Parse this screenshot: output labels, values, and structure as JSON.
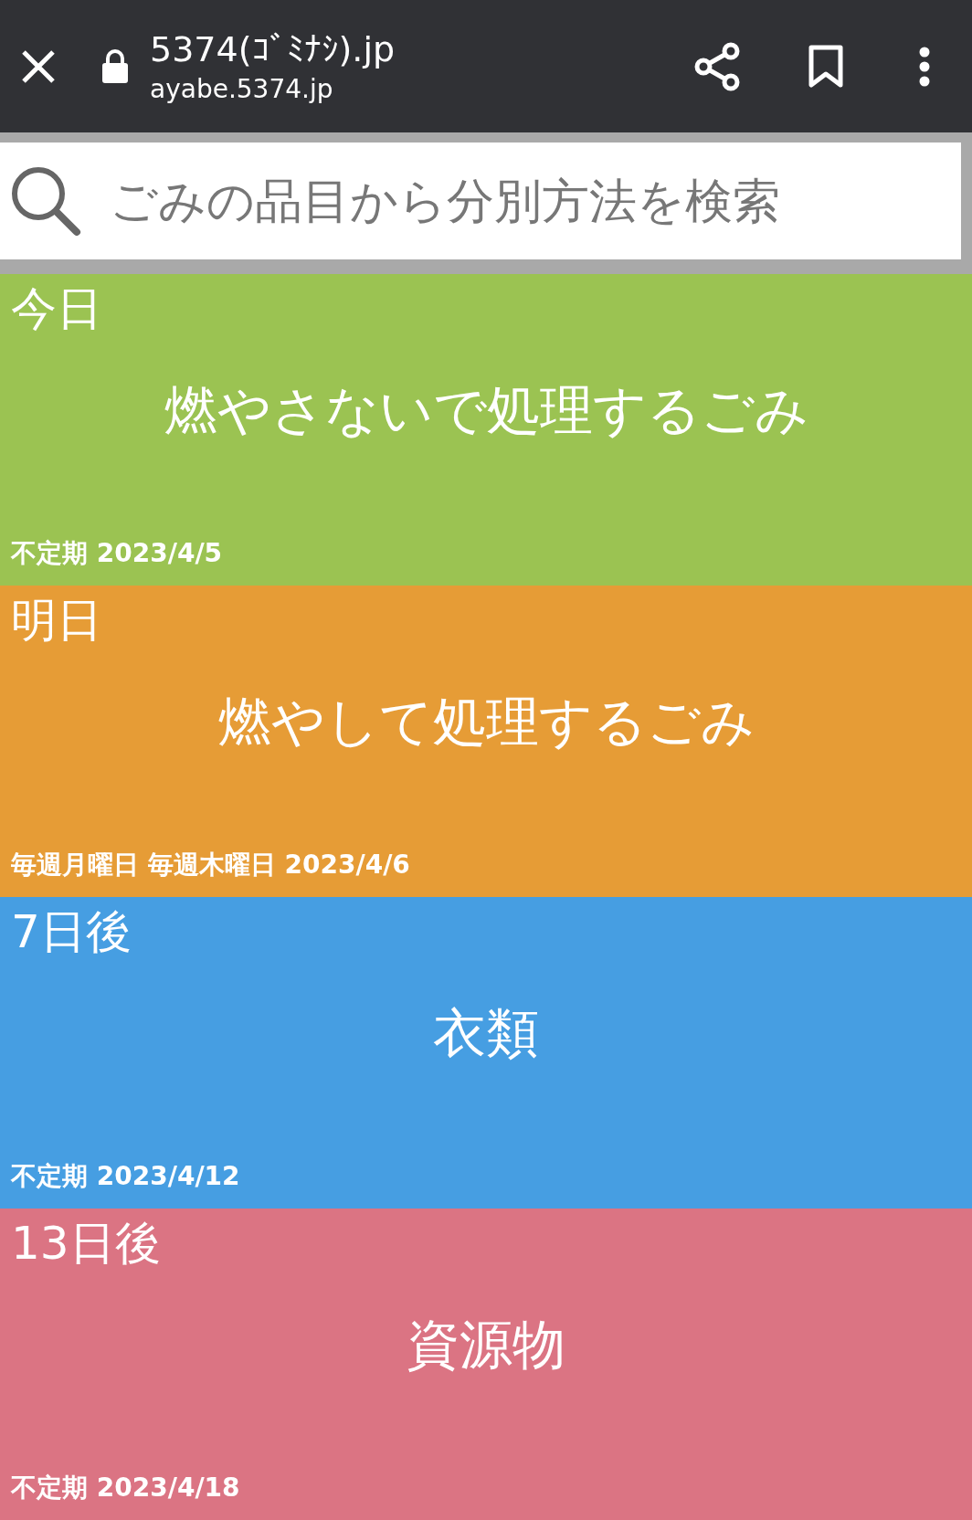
{
  "toolbar": {
    "title": "5374(ｺﾞﾐﾅｼ).jp",
    "url": "ayabe.5374.jp"
  },
  "search": {
    "placeholder": "ごみの品目から分別方法を検索"
  },
  "schedule": [
    {
      "when": "今日",
      "category": "燃やさないで処理するごみ",
      "detail": "不定期 2023/4/5",
      "color": "#9bc352"
    },
    {
      "when": "明日",
      "category": "燃やして処理するごみ",
      "detail": "毎週月曜日 毎週木曜日 2023/4/6",
      "color": "#e69c36"
    },
    {
      "when": "7日後",
      "category": "衣類",
      "detail": "不定期 2023/4/12",
      "color": "#469ee2"
    },
    {
      "when": "13日後",
      "category": "資源物",
      "detail": "不定期 2023/4/18",
      "color": "#db7483"
    }
  ]
}
